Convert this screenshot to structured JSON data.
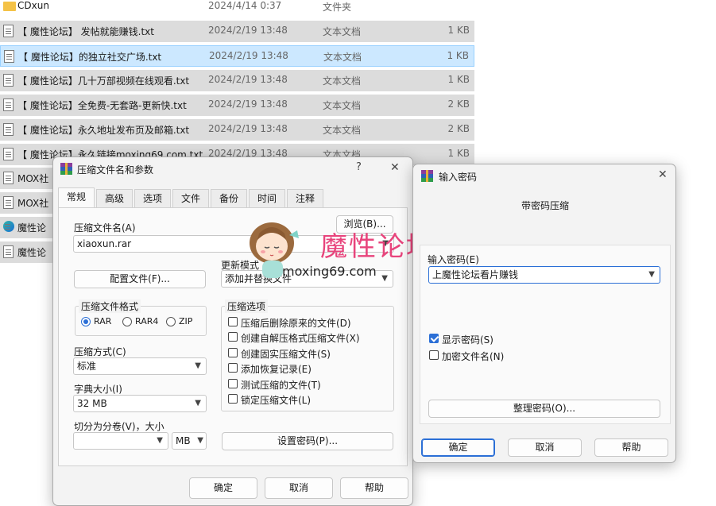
{
  "explorer": {
    "files": [
      {
        "name": "CDxun",
        "date": "2024/4/14 0:37",
        "type": "文件夹",
        "size": "",
        "icon": "folder-icon",
        "state": "plain"
      },
      {
        "name": "【 魔性论坛】 发帖就能赚钱.txt",
        "date": "2024/2/19 13:48",
        "type": "文本文档",
        "size": "1 KB",
        "icon": "text-file-icon",
        "state": "grey"
      },
      {
        "name": "【 魔性论坛】的独立社交广场.txt",
        "date": "2024/2/19 13:48",
        "type": "文本文档",
        "size": "1 KB",
        "icon": "text-file-icon",
        "state": "selected"
      },
      {
        "name": "【 魔性论坛】几十万部视频在线观看.txt",
        "date": "2024/2/19 13:48",
        "type": "文本文档",
        "size": "1 KB",
        "icon": "text-file-icon",
        "state": "grey"
      },
      {
        "name": "【 魔性论坛】全免费-无套路-更新快.txt",
        "date": "2024/2/19 13:48",
        "type": "文本文档",
        "size": "2 KB",
        "icon": "text-file-icon",
        "state": "grey"
      },
      {
        "name": "【 魔性论坛】永久地址发布页及邮箱.txt",
        "date": "2024/2/19 13:48",
        "type": "文本文档",
        "size": "2 KB",
        "icon": "text-file-icon",
        "state": "grey"
      },
      {
        "name": "【 魔性论坛】永久链接moxing69.com.txt",
        "date": "2024/2/19 13:48",
        "type": "文本文档",
        "size": "1 KB",
        "icon": "text-file-icon",
        "state": "grey"
      },
      {
        "name": "MOX社",
        "date": "",
        "type": "",
        "size": "",
        "icon": "file-icon",
        "state": "grey"
      },
      {
        "name": "MOX社",
        "date": "",
        "type": "",
        "size": "",
        "icon": "file-icon",
        "state": "grey"
      },
      {
        "name": "魔性论",
        "date": "",
        "type": "",
        "size": "",
        "icon": "edge-icon",
        "state": "grey"
      },
      {
        "name": "魔性论",
        "date": "",
        "type": "",
        "size": "",
        "icon": "file-icon",
        "state": "grey"
      }
    ]
  },
  "archive_dialog": {
    "title": "压缩文件名和参数",
    "help_symbol": "?",
    "close_symbol": "✕",
    "tabs": [
      "常规",
      "高级",
      "选项",
      "文件",
      "备份",
      "时间",
      "注释"
    ],
    "archive_name_label": "压缩文件名(A)",
    "browse_button": "浏览(B)...",
    "archive_name_value": "xiaoxun.rar",
    "update_mode_label": "更新模式",
    "update_mode_value": "添加并替换文件",
    "profiles_button": "配置文件(F)...",
    "format_group_title": "压缩文件格式",
    "formats": [
      {
        "label": "RAR",
        "checked": true
      },
      {
        "label": "RAR4",
        "checked": false
      },
      {
        "label": "ZIP",
        "checked": false
      }
    ],
    "method_label": "压缩方式(C)",
    "method_value": "标准",
    "dict_label": "字典大小(I)",
    "dict_value": "32 MB",
    "split_label": "切分为分卷(V)，大小",
    "split_value": "",
    "split_unit": "MB",
    "options_group_title": "压缩选项",
    "options": [
      {
        "label": "压缩后删除原来的文件(D)",
        "checked": false
      },
      {
        "label": "创建自解压格式压缩文件(X)",
        "checked": false
      },
      {
        "label": "创建固实压缩文件(S)",
        "checked": false
      },
      {
        "label": "添加恢复记录(E)",
        "checked": false
      },
      {
        "label": "测试压缩的文件(T)",
        "checked": false
      },
      {
        "label": "锁定压缩文件(L)",
        "checked": false
      }
    ],
    "set_password_button": "设置密码(P)...",
    "ok_button": "确定",
    "cancel_button": "取消",
    "help_button": "帮助"
  },
  "password_dialog": {
    "title": "输入密码",
    "close_symbol": "✕",
    "heading": "带密码压缩",
    "password_label": "输入密码(E)",
    "password_value": "上魔性论坛看片赚钱",
    "show_password_label": "显示密码(S)",
    "show_password_checked": true,
    "encrypt_names_label": "加密文件名(N)",
    "encrypt_names_checked": false,
    "organize_button": "整理密码(O)...",
    "ok_button": "确定",
    "cancel_button": "取消",
    "help_button": "帮助"
  },
  "watermark": {
    "brand_text": "魔性论坛",
    "site_text": "moxing69.com"
  },
  "colors": {
    "accent": "#2b6fd6",
    "selection": "#cce8ff",
    "watermark": "#e8447c"
  }
}
